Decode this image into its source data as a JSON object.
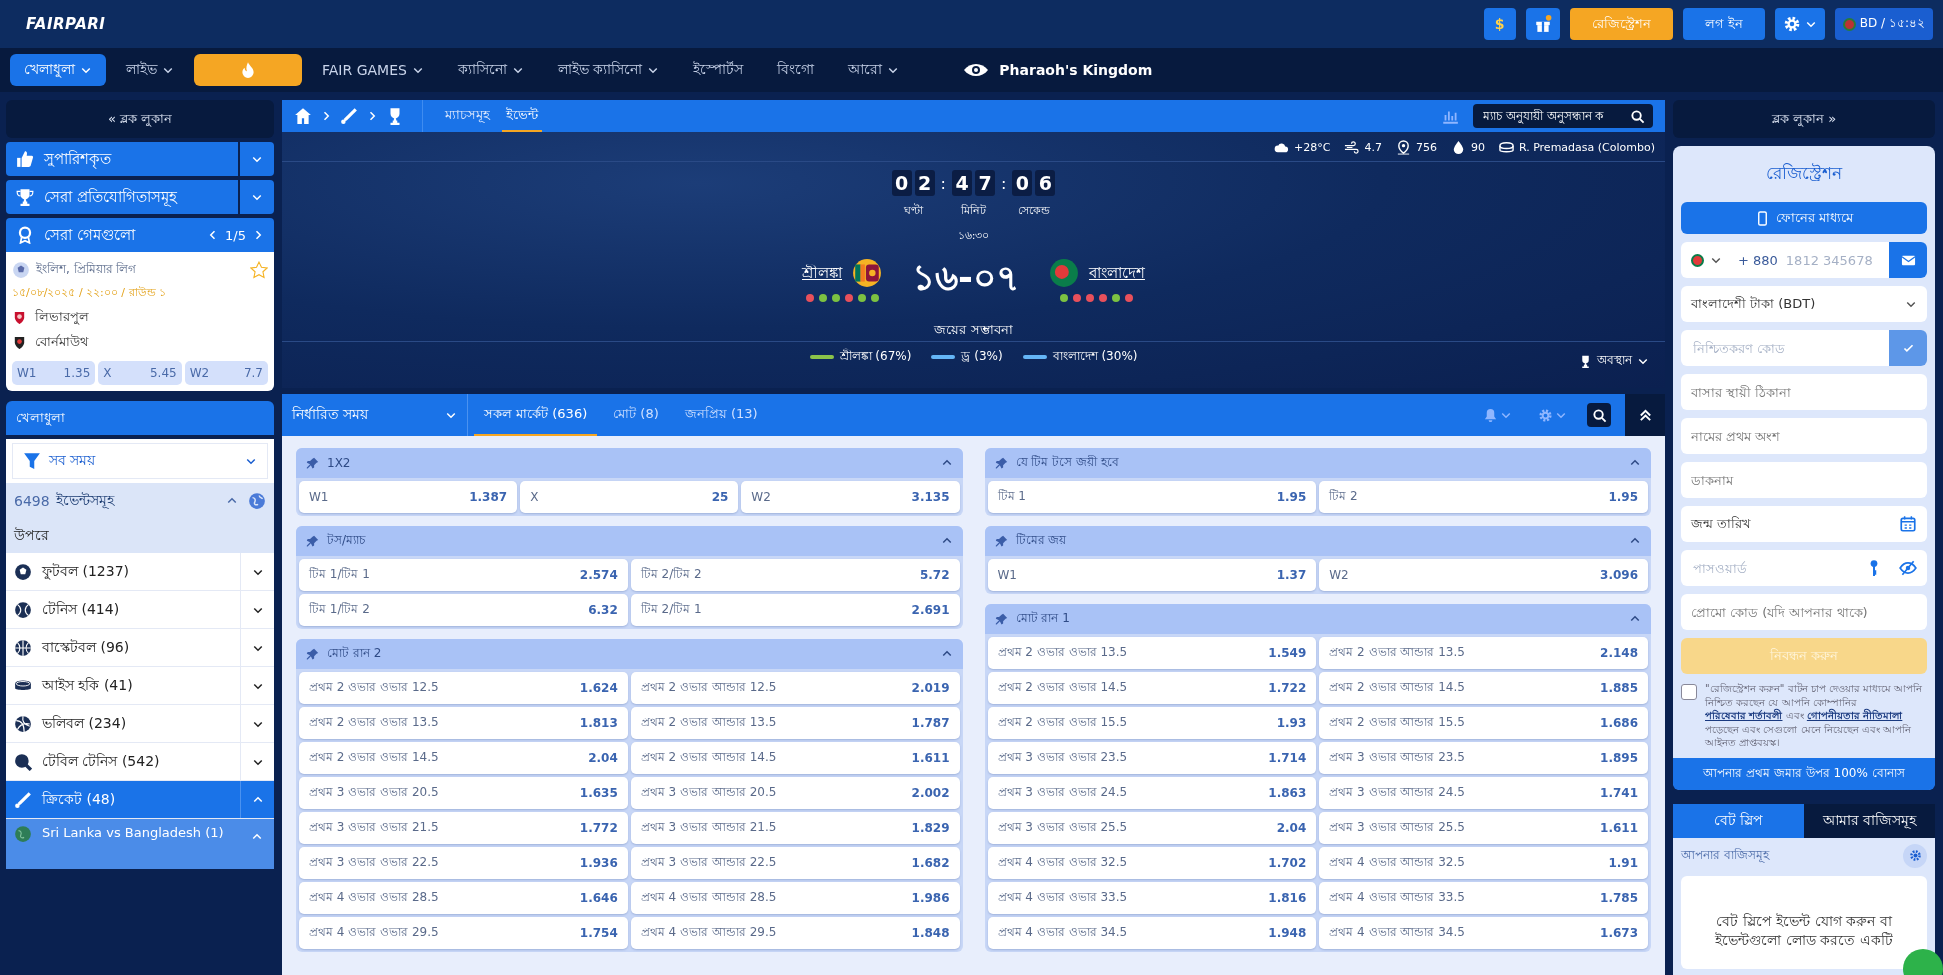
{
  "header": {
    "logo": "FAIRPARI",
    "currency": "$",
    "register": "রেজিস্ট্রেশন",
    "login": "লগ ইন",
    "region": "BD / ১৫:৪২"
  },
  "nav": [
    {
      "kind": "link",
      "label": "খেলাধুলা",
      "selected": true,
      "dropdown": true
    },
    {
      "kind": "link",
      "label": "লাইভ",
      "selected": false,
      "dropdown": true
    },
    {
      "kind": "promo",
      "selected": false,
      "dropdown": false
    },
    {
      "kind": "link",
      "label": "FAIR GAMES",
      "selected": false,
      "dropdown": true
    },
    {
      "kind": "link",
      "label": "ক্যাসিনো",
      "selected": false,
      "dropdown": true
    },
    {
      "kind": "link",
      "label": "লাইভ ক্যাসিনো",
      "selected": false,
      "dropdown": true
    },
    {
      "kind": "link",
      "label": "ইস্পোর্টস",
      "selected": false,
      "dropdown": false
    },
    {
      "kind": "link",
      "label": "বিংগো",
      "selected": false,
      "dropdown": false
    },
    {
      "kind": "link",
      "label": "আরো",
      "selected": false,
      "dropdown": true
    },
    {
      "kind": "brand",
      "label": "Pharaoh's Kingdom",
      "selected": false,
      "dropdown": false
    }
  ],
  "left_sidebar": {
    "hide_label": "« ব্লক লুকান",
    "sections": [
      {
        "kind": "thumbs",
        "label": "সুপারিশকৃত"
      },
      {
        "kind": "trophy",
        "label": "সেরা প্রতিযোগিতাসমূহ"
      }
    ],
    "top_games": {
      "label": "সেরা গেমগুলো",
      "pager": "1/5",
      "league": "ইংলিশ, প্রিমিয়ার লিগ",
      "favorite": false,
      "date": "১৫/০৮/২০২৫ / ২২:০০ / রাউন্ড ১",
      "teams": [
        "লিভারপুল",
        "বোর্নমাউথ"
      ],
      "odds": [
        {
          "label": "W1",
          "value": "1.35"
        },
        {
          "label": "X",
          "value": "5.45"
        },
        {
          "label": "W2",
          "value": "7.7"
        }
      ]
    },
    "sports": {
      "title": "খেলাধুলা",
      "filter": "সব সময়",
      "events_count": "6498",
      "events_label": "ইভেন্টসমূহ",
      "top_label": "উপরে",
      "items": [
        {
          "kind": "football",
          "label": "ফুটবল (1237)",
          "selected": false,
          "expanded": false
        },
        {
          "kind": "tennis",
          "label": "টেনিস (414)",
          "selected": false,
          "expanded": false
        },
        {
          "kind": "basketball",
          "label": "বাস্কেটবল (96)",
          "selected": false,
          "expanded": false
        },
        {
          "kind": "hockey",
          "label": "আইস হকি (41)",
          "selected": false,
          "expanded": false
        },
        {
          "kind": "volleyball",
          "label": "ভলিবল (234)",
          "selected": false,
          "expanded": false
        },
        {
          "kind": "table_tennis",
          "label": "টেবিল টেনিস (542)",
          "selected": false,
          "expanded": false
        },
        {
          "kind": "cricket",
          "label": "ক্রিকেট (48)",
          "selected": true,
          "expanded": true,
          "children": [
            {
              "label": "Sri Lanka vs Bangladesh (1)",
              "expanded": true
            }
          ]
        }
      ]
    }
  },
  "breadcrumb": {
    "links": [
      {
        "label": "ম্যাচসমূহ",
        "selected": false
      },
      {
        "label": "ইভেন্ট",
        "selected": true
      }
    ],
    "search_placeholder": "ম্যাচ অনুযায়ী অনুসন্ধান ক"
  },
  "match": {
    "weather": [
      {
        "kind": "cloud",
        "text": "+28°C"
      },
      {
        "kind": "wind",
        "text": "4.7"
      },
      {
        "kind": "pin",
        "text": "756"
      },
      {
        "kind": "drop",
        "text": "90"
      },
      {
        "kind": "stadium",
        "text": "R. Premadasa (Colombo)"
      }
    ],
    "countdown": [
      {
        "digits": [
          "0",
          "2"
        ],
        "unit": "ঘণ্টা"
      },
      {
        "digits": [
          "4",
          "7"
        ],
        "unit": "মিনিট"
      },
      {
        "digits": [
          "0",
          "6"
        ],
        "unit": "সেকেন্ড"
      }
    ],
    "countdown_separator": ":",
    "start_time": "১৬:৩০",
    "score": "১৬-০৭",
    "teams": [
      {
        "name": "শ্রীলঙ্কা",
        "kind": "lk",
        "form": [
          {
            "color": "#e8505b"
          },
          {
            "color": "#7cc242"
          },
          {
            "color": "#7cc242"
          },
          {
            "color": "#e8505b"
          },
          {
            "color": "#7cc242"
          },
          {
            "color": "#7cc242"
          }
        ]
      },
      {
        "name": "বাংলাদেশ",
        "kind": "bd",
        "form": [
          {
            "color": "#7cc242"
          },
          {
            "color": "#e8505b"
          },
          {
            "color": "#e8505b"
          },
          {
            "color": "#e8505b"
          },
          {
            "color": "#7cc242"
          },
          {
            "color": "#e8505b"
          }
        ]
      }
    ],
    "probability_title": "জয়ের সম্ভাবনা",
    "probabilities": [
      {
        "label": "শ্রীলঙ্কা (67%)",
        "color": "#8bc34a"
      },
      {
        "label": "ড্র (3%)",
        "color": "#64b5f6"
      },
      {
        "label": "বাংলাদেশ (30%)",
        "color": "#64b5f6"
      }
    ],
    "standings_label": "অবস্থান"
  },
  "market_bar": {
    "period": "নির্ধারিত সময়",
    "tabs": [
      {
        "label": "সকল মার্কেট (636)",
        "selected": true
      },
      {
        "label": "মোট (8)",
        "selected": false
      },
      {
        "label": "জনপ্রিয় (13)",
        "selected": false
      }
    ]
  },
  "markets": {
    "columns": [
      [
        {
          "title": "1X2",
          "rows": [
            [
              {
                "label": "W1",
                "odds": "1.387"
              },
              {
                "label": "X",
                "odds": "25"
              },
              {
                "label": "W2",
                "odds": "3.135"
              }
            ]
          ]
        },
        {
          "title": "টস/ম্যাচ",
          "rows": [
            [
              {
                "label": "টিম 1/টিম 1",
                "odds": "2.574"
              },
              {
                "label": "টিম 2/টিম 2",
                "odds": "5.72"
              }
            ],
            [
              {
                "label": "টিম 1/টিম 2",
                "odds": "6.32"
              },
              {
                "label": "টিম 2/টিম 1",
                "odds": "2.691"
              }
            ]
          ]
        },
        {
          "title": "মোট রান 2",
          "rows": [
            [
              {
                "label": "প্রথম 2 ওভার ওভার 12.5",
                "odds": "1.624"
              },
              {
                "label": "প্রথম 2 ওভার আন্ডার 12.5",
                "odds": "2.019"
              }
            ],
            [
              {
                "label": "প্রথম 2 ওভার ওভার 13.5",
                "odds": "1.813"
              },
              {
                "label": "প্রথম 2 ওভার আন্ডার 13.5",
                "odds": "1.787"
              }
            ],
            [
              {
                "label": "প্রথম 2 ওভার ওভার 14.5",
                "odds": "2.04"
              },
              {
                "label": "প্রথম 2 ওভার আন্ডার 14.5",
                "odds": "1.611"
              }
            ],
            [
              {
                "label": "প্রথম 3 ওভার ওভার 20.5",
                "odds": "1.635"
              },
              {
                "label": "প্রথম 3 ওভার আন্ডার 20.5",
                "odds": "2.002"
              }
            ],
            [
              {
                "label": "প্রথম 3 ওভার ওভার 21.5",
                "odds": "1.772"
              },
              {
                "label": "প্রথম 3 ওভার আন্ডার 21.5",
                "odds": "1.829"
              }
            ],
            [
              {
                "label": "প্রথম 3 ওভার ওভার 22.5",
                "odds": "1.936"
              },
              {
                "label": "প্রথম 3 ওভার আন্ডার 22.5",
                "odds": "1.682"
              }
            ],
            [
              {
                "label": "প্রথম 4 ওভার ওভার 28.5",
                "odds": "1.646"
              },
              {
                "label": "প্রথম 4 ওভার আন্ডার 28.5",
                "odds": "1.986"
              }
            ],
            [
              {
                "label": "প্রথম 4 ওভার ওভার 29.5",
                "odds": "1.754"
              },
              {
                "label": "প্রথম 4 ওভার আন্ডার 29.5",
                "odds": "1.848"
              }
            ]
          ]
        }
      ],
      [
        {
          "title": "যে টিম টসে জয়ী হবে",
          "rows": [
            [
              {
                "label": "টিম 1",
                "odds": "1.95"
              },
              {
                "label": "টিম 2",
                "odds": "1.95"
              }
            ]
          ]
        },
        {
          "title": "টিমের জয়",
          "rows": [
            [
              {
                "label": "W1",
                "odds": "1.37"
              },
              {
                "label": "W2",
                "odds": "3.096"
              }
            ]
          ]
        },
        {
          "title": "মোট রান 1",
          "rows": [
            [
              {
                "label": "প্রথম 2 ওভার ওভার 13.5",
                "odds": "1.549"
              },
              {
                "label": "প্রথম 2 ওভার আন্ডার 13.5",
                "odds": "2.148"
              }
            ],
            [
              {
                "label": "প্রথম 2 ওভার ওভার 14.5",
                "odds": "1.722"
              },
              {
                "label": "প্রথম 2 ওভার আন্ডার 14.5",
                "odds": "1.885"
              }
            ],
            [
              {
                "label": "প্রথম 2 ওভার ওভার 15.5",
                "odds": "1.93"
              },
              {
                "label": "প্রথম 2 ওভার আন্ডার 15.5",
                "odds": "1.686"
              }
            ],
            [
              {
                "label": "প্রথম 3 ওভার ওভার 23.5",
                "odds": "1.714"
              },
              {
                "label": "প্রথম 3 ওভার আন্ডার 23.5",
                "odds": "1.895"
              }
            ],
            [
              {
                "label": "প্রথম 3 ওভার ওভার 24.5",
                "odds": "1.863"
              },
              {
                "label": "প্রথম 3 ওভার আন্ডার 24.5",
                "odds": "1.741"
              }
            ],
            [
              {
                "label": "প্রথম 3 ওভার ওভার 25.5",
                "odds": "2.04"
              },
              {
                "label": "প্রথম 3 ওভার আন্ডার 25.5",
                "odds": "1.611"
              }
            ],
            [
              {
                "label": "প্রথম 4 ওভার ওভার 32.5",
                "odds": "1.702"
              },
              {
                "label": "প্রথম 4 ওভার আন্ডার 32.5",
                "odds": "1.91"
              }
            ],
            [
              {
                "label": "প্রথম 4 ওভার ওভার 33.5",
                "odds": "1.816"
              },
              {
                "label": "প্রথম 4 ওভার আন্ডার 33.5",
                "odds": "1.785"
              }
            ],
            [
              {
                "label": "প্রথম 4 ওভার ওভার 34.5",
                "odds": "1.948"
              },
              {
                "label": "প্রথম 4 ওভার আন্ডার 34.5",
                "odds": "1.673"
              }
            ]
          ]
        }
      ]
    ]
  },
  "right_sidebar": {
    "hide_label": "ব্লক লুকান »",
    "registration": {
      "title": "রেজিস্ট্রেশন",
      "method_button": "ফোনের মাধ্যমে",
      "phone_code": "+ 880",
      "phone_placeholder": "1812 345678",
      "currency": "বাংলাদেশী টাকা (BDT)",
      "fields": [
        {
          "kind": "confirm",
          "placeholder": "নিশ্চিতকরণ কোড"
        },
        {
          "kind": "text",
          "placeholder": "বাসার স্থায়ী ঠিকানা"
        },
        {
          "kind": "text",
          "placeholder": "নামের প্রথম অংশ"
        },
        {
          "kind": "text",
          "placeholder": "ডাকনাম"
        },
        {
          "kind": "date",
          "value": "জন্ম তারিখ"
        },
        {
          "kind": "password",
          "placeholder": "পাসওয়ার্ড"
        },
        {
          "kind": "text",
          "placeholder": "প্রোমো কোড (যদি আপনার থাকে)"
        }
      ],
      "submit": {
        "label": "নিবন্ধন করুন",
        "disabled": true
      },
      "consent": {
        "checked": false,
        "segments": [
          {
            "kind": "text",
            "text": "\"রেজিস্ট্রেশন করুন\" বাটন চাপ দেওয়ার মাধ্যমে আপনি নিশ্চিত করছেন যে আপনি কোম্পানির "
          },
          {
            "kind": "link",
            "text": "পরিষেবার শর্তাবলী"
          },
          {
            "kind": "text",
            "text": " এবং "
          },
          {
            "kind": "link",
            "text": "গোপনীয়তার নীতিমালা"
          },
          {
            "kind": "text",
            "text": " পড়েছেন এবং সেগুলো মেনে নিয়েছেন এবং আপনি আইনত প্রাপ্তবয়স্ক।"
          }
        ]
      },
      "bonus": "আপনার প্রথম জমার উপর 100% বোনাস"
    },
    "betslip": {
      "tabs": [
        {
          "label": "বেট স্লিপ",
          "selected": true
        },
        {
          "label": "আমার বাজিসমূহ",
          "selected": false
        }
      ],
      "title": "আপনার বাজিসমূহ",
      "message": "বেট স্লিপে ইভেন্ট যোগ করুন বা ইভেন্টগুলো লোড করতে একটি"
    }
  }
}
